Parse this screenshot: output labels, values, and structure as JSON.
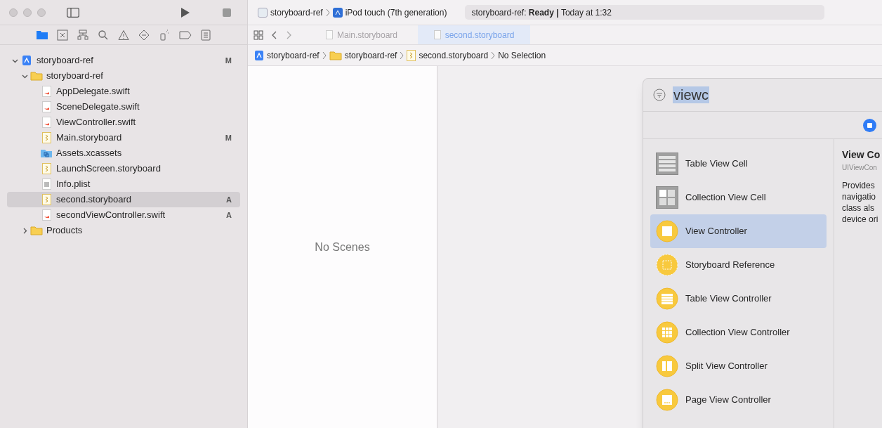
{
  "toolbar": {
    "scheme": "storyboard-ref",
    "device": "iPod touch (7th generation)",
    "status": {
      "project": "storyboard-ref:",
      "state": "Ready |",
      "time": "Today at 1:32"
    }
  },
  "navigator": {
    "tree": [
      {
        "label": "storyboard-ref",
        "kind": "project",
        "badge": "M",
        "expanded": true,
        "selected": false,
        "children": [
          {
            "label": "storyboard-ref",
            "kind": "folder",
            "expanded": true,
            "selected": false,
            "children": [
              {
                "label": "AppDelegate.swift",
                "kind": "swift",
                "selected": false
              },
              {
                "label": "SceneDelegate.swift",
                "kind": "swift",
                "selected": false
              },
              {
                "label": "ViewController.swift",
                "kind": "swift",
                "selected": false
              },
              {
                "label": "Main.storyboard",
                "kind": "storyboard",
                "badge": "M",
                "selected": false
              },
              {
                "label": "Assets.xcassets",
                "kind": "assets",
                "selected": false
              },
              {
                "label": "LaunchScreen.storyboard",
                "kind": "storyboard",
                "selected": false
              },
              {
                "label": "Info.plist",
                "kind": "plist",
                "selected": false
              },
              {
                "label": "second.storyboard",
                "kind": "storyboard",
                "badge": "A",
                "selected": true
              },
              {
                "label": "secondViewController.swift",
                "kind": "swift",
                "badge": "A",
                "selected": false
              }
            ]
          },
          {
            "label": "Products",
            "kind": "folder",
            "expanded": false,
            "selected": false
          }
        ]
      }
    ]
  },
  "tabs": [
    {
      "label": "Main.storyboard",
      "selected": false
    },
    {
      "label": "second.storyboard",
      "selected": true
    }
  ],
  "breadcrumb": [
    {
      "label": "storyboard-ref",
      "kind": "project"
    },
    {
      "label": "storyboard-ref",
      "kind": "folder"
    },
    {
      "label": "second.storyboard",
      "kind": "storyboard"
    },
    {
      "label": "No Selection",
      "kind": "text"
    }
  ],
  "outline": {
    "empty_text": "No Scenes"
  },
  "library": {
    "search": "viewc",
    "items": [
      {
        "label": "Table View Cell",
        "kind": "table-cell",
        "selected": false
      },
      {
        "label": "Collection View Cell",
        "kind": "collection-cell",
        "selected": false
      },
      {
        "label": "View Controller",
        "kind": "view-controller",
        "selected": true
      },
      {
        "label": "Storyboard Reference",
        "kind": "reference",
        "selected": false
      },
      {
        "label": "Table View Controller",
        "kind": "table-controller",
        "selected": false
      },
      {
        "label": "Collection View Controller",
        "kind": "collection-controller",
        "selected": false
      },
      {
        "label": "Split View Controller",
        "kind": "split-controller",
        "selected": false
      },
      {
        "label": "Page View Controller",
        "kind": "page-controller",
        "selected": false
      }
    ],
    "detail": {
      "title": "View Co",
      "class": "UIViewCon",
      "description": [
        "Provides",
        "navigatio",
        "class als",
        "device ori"
      ]
    }
  }
}
